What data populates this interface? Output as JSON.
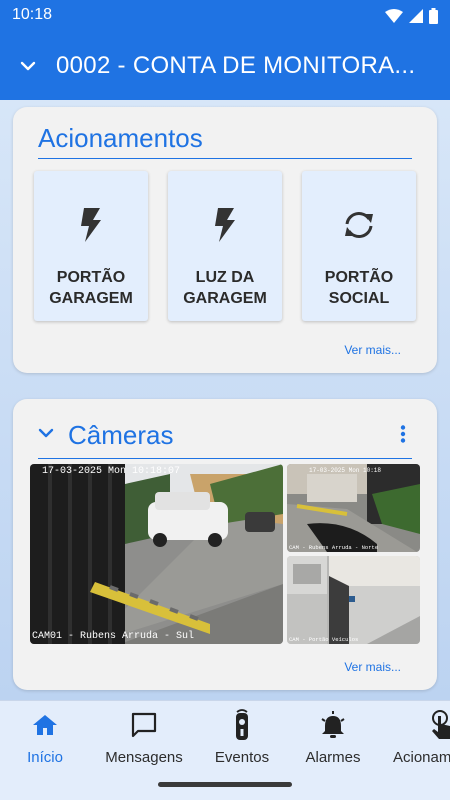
{
  "status_bar": {
    "time": "10:18"
  },
  "app_bar": {
    "title": "0002 - CONTA DE MONITORA..."
  },
  "actions_card": {
    "title": "Acionamentos",
    "tiles": [
      {
        "label": "PORTÃO GARAGEM",
        "icon": "bolt-icon"
      },
      {
        "label": "LUZ DA GARAGEM",
        "icon": "bolt-icon"
      },
      {
        "label": "PORTÃO SOCIAL",
        "icon": "sync-icon"
      }
    ],
    "see_more": "Ver mais..."
  },
  "cameras_card": {
    "title": "Câmeras",
    "main_camera": {
      "timestamp": "17-03-2025 Mon 10:18:07",
      "caption": "CAM01 - Rubens Arruda - Sul"
    },
    "cam2": {
      "timestamp": "17-03-2025 Mon 10:18",
      "caption": "CAM - Rubens Arruda - Norte"
    },
    "cam3": {
      "timestamp": "",
      "caption": "CAM - Portão Veículos"
    },
    "see_more": "Ver mais..."
  },
  "bottom_nav": {
    "items": [
      {
        "label": "Início",
        "icon": "home-icon",
        "active": true
      },
      {
        "label": "Mensagens",
        "icon": "message-icon",
        "active": false
      },
      {
        "label": "Eventos",
        "icon": "remote-icon",
        "active": false
      },
      {
        "label": "Alarmes",
        "icon": "alarm-bell-icon",
        "active": false
      },
      {
        "label": "Acionam",
        "icon": "touch-icon",
        "active": false
      }
    ]
  },
  "colors": {
    "primary": "#1f73e3",
    "background": "#c9dcf5",
    "card": "#f2f2f2",
    "tile": "#e3eefd"
  }
}
